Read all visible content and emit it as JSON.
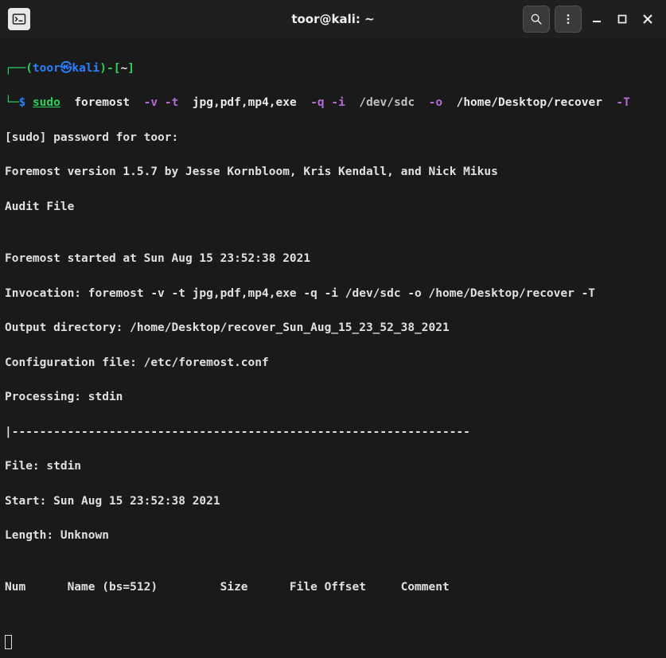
{
  "titlebar": {
    "title": "toor@kali: ~"
  },
  "prompt": {
    "user": "toor",
    "host": "kali",
    "path": "~",
    "symbol": "$"
  },
  "command": {
    "sudo": "sudo",
    "program": "foremost",
    "flag_v": "-v",
    "flag_t": "-t",
    "types": "jpg,pdf,mp4,exe",
    "flag_q": "-q",
    "flag_i": "-i",
    "input_dev": "/dev/sdc",
    "flag_o": "-o",
    "output_dir": "/home/Desktop/recover",
    "flag_T": "-T"
  },
  "output": {
    "sudo_prompt": "[sudo] password for toor:",
    "version": "Foremost version 1.5.7 by Jesse Kornbloom, Kris Kendall, and Nick Mikus",
    "audit": "Audit File",
    "blank1": "",
    "started": "Foremost started at Sun Aug 15 23:52:38 2021",
    "invocation": "Invocation: foremost -v -t jpg,pdf,mp4,exe -q -i /dev/sdc -o /home/Desktop/recover -T",
    "outdir": "Output directory: /home/Desktop/recover_Sun_Aug_15_23_52_38_2021",
    "config": "Configuration file: /etc/foremost.conf",
    "processing": "Processing: stdin",
    "sep": "|------------------------------------------------------------------",
    "file": "File: stdin",
    "start": "Start: Sun Aug 15 23:52:38 2021",
    "length": "Length: Unknown",
    "blank2": "",
    "header": "Num      Name (bs=512)         Size      File Offset     Comment",
    "blank3": ""
  }
}
